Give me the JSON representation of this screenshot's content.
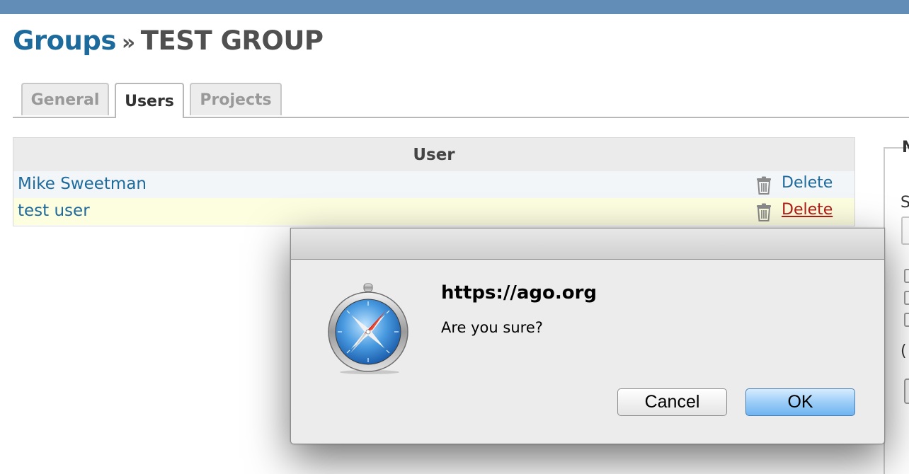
{
  "breadcrumb": {
    "parent": "Groups",
    "separator": "»",
    "current": "TEST GROUP"
  },
  "tabs": [
    {
      "label": "General",
      "active": false
    },
    {
      "label": "Users",
      "active": true
    },
    {
      "label": "Projects",
      "active": false
    }
  ],
  "users_table": {
    "header": "User",
    "rows": [
      {
        "name": "Mike Sweetman",
        "action": "Delete"
      },
      {
        "name": "test user",
        "action": "Delete"
      }
    ]
  },
  "sidebar_partial": {
    "letter_top": "N",
    "letter_s": "S",
    "paren": "("
  },
  "dialog": {
    "host": "https://ago.org",
    "message": "Are you sure?",
    "cancel_label": "Cancel",
    "ok_label": "OK",
    "icon": "safari-compass-icon"
  },
  "colors": {
    "topbar": "#628db6",
    "link": "#1d6a9d",
    "hover_link": "#b01c14",
    "ok_button": "#8cc6f5"
  }
}
